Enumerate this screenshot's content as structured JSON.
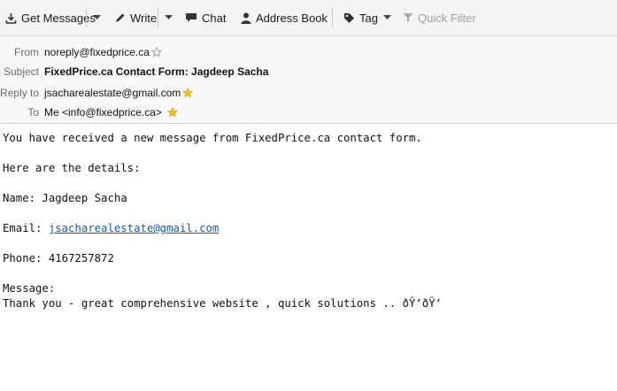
{
  "toolbar": {
    "get_messages": "Get Messages",
    "write": "Write",
    "chat": "Chat",
    "address_book": "Address Book",
    "tag": "Tag",
    "quick_filter": "Quick Filter"
  },
  "header": {
    "from_label": "From",
    "from_value": "noreply@fixedprice.ca",
    "subject_label": "Subject",
    "subject_value": "FixedPrice.ca Contact Form: Jagdeep Sacha",
    "replyto_label": "Reply to",
    "replyto_value": "jsacharealestate@gmail.com",
    "to_label": "To",
    "to_value": "Me <info@fixedprice.ca>"
  },
  "message": {
    "line1": "You have received a new message from FixedPrice.ca contact form.",
    "line2": "Here are the details:",
    "name_line": "Name: Jagdeep Sacha",
    "email_prefix": "Email: ",
    "email_link": "jsacharealestate@gmail.com",
    "phone_line": "Phone: 4167257872",
    "message_label": "Message:",
    "message_text": "Thank you - great comprehensive website , quick solutions .. ðŸ‘ðŸ‘"
  },
  "colors": {
    "toolbar_bg": "#f4f4f4",
    "header_bg": "#f8f8f8",
    "link": "#0b5cc5",
    "star_filled": "#f5c518"
  }
}
